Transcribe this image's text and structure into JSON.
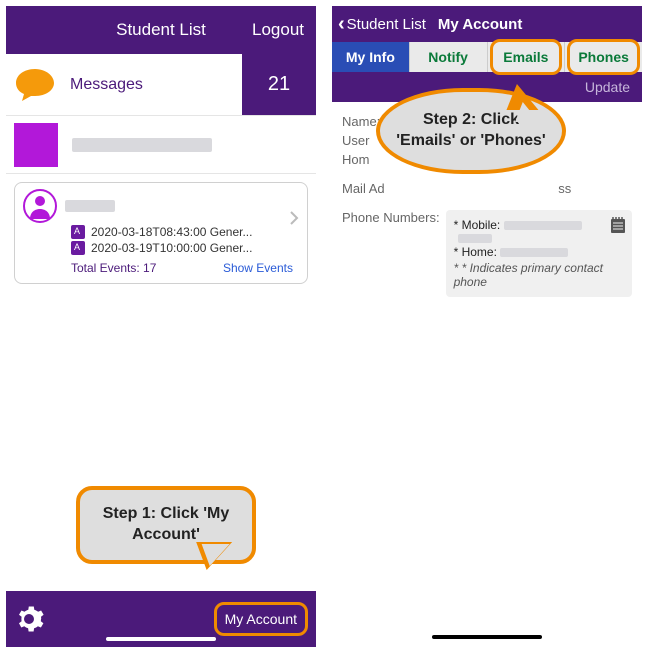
{
  "left": {
    "header": {
      "title": "Student List",
      "logout": "Logout"
    },
    "messages": {
      "label": "Messages",
      "count": "21"
    },
    "card": {
      "event1": "2020-03-18T08:43:00 Gener...",
      "event2": "2020-03-19T10:00:00 Gener...",
      "total": "Total Events: 17",
      "show": "Show Events"
    },
    "footer": {
      "my_account": "My Account"
    }
  },
  "right": {
    "back": "Student List",
    "title": "My Account",
    "tabs": {
      "myinfo": "My Info",
      "notify": "Notify",
      "emails": "Emails",
      "phones": "Phones"
    },
    "update": "Update",
    "info": {
      "name": "Name:",
      "user": "User",
      "home": "Hom",
      "mail": "Mail Ad",
      "mail_suffix": "ss",
      "phone_lbl": "Phone Numbers:",
      "mobile": "* Mobile:",
      "home_num": "* Home:",
      "note": "* * Indicates primary contact phone"
    }
  },
  "callouts": {
    "step1": "Step 1: Click 'My Account'",
    "step2": "Step 2: Click 'Emails' or 'Phones'"
  }
}
